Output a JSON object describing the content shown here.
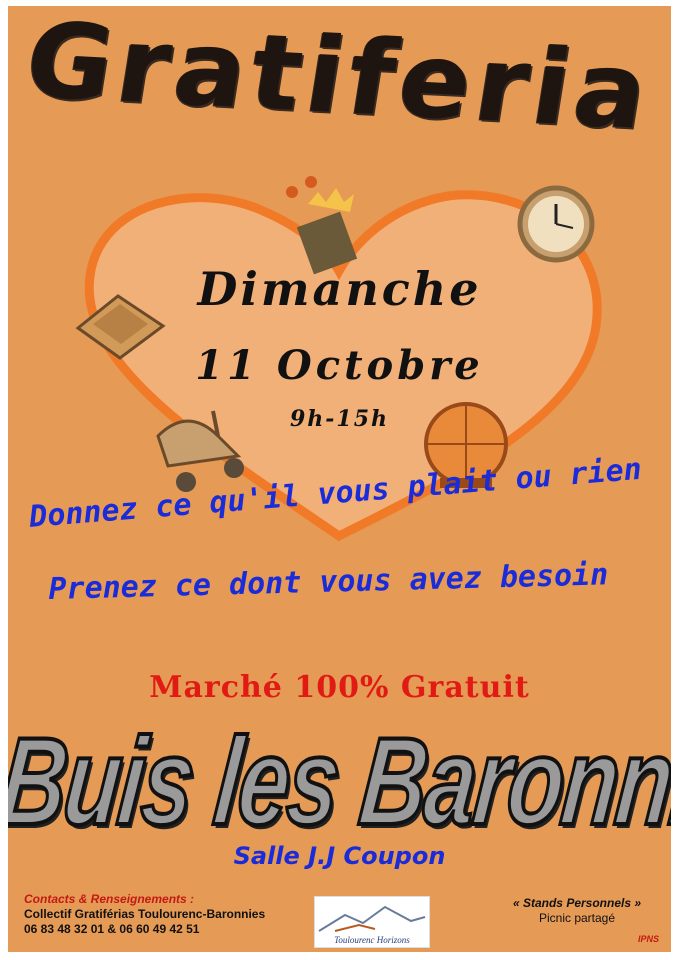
{
  "title": "Gratiferia",
  "event": {
    "day": "Dimanche",
    "date": "11 Octobre",
    "hours": "9h-15h"
  },
  "slogan": {
    "line1": "Donnez ce qu'il vous plait ou rien",
    "line2": "Prenez ce dont vous avez besoin"
  },
  "market_label": "Marché 100% Gratuit",
  "town": "Buis les Baronnies",
  "venue": "Salle J.J Coupon",
  "contacts": {
    "heading": "Contacts & Renseignements :",
    "organizer": "Collectif Gratiférias Toulourenc-Baronnies",
    "phones": "06 83 48 32 01 & 06 60 49 42 51"
  },
  "logo": {
    "text": "Toulourenc Horizons"
  },
  "stands": {
    "title": "« Stands Personnels »",
    "subtitle": "Picnic partagé"
  },
  "ipns": "IPNS",
  "colors": {
    "background": "#e59a55",
    "heart": "#f07a28",
    "slogan": "#1a2bd9",
    "market": "#e11a14"
  },
  "icons": [
    "flower-vase-icon",
    "clock-icon",
    "book-icon",
    "pram-icon",
    "globe-icon",
    "heart-icon"
  ]
}
